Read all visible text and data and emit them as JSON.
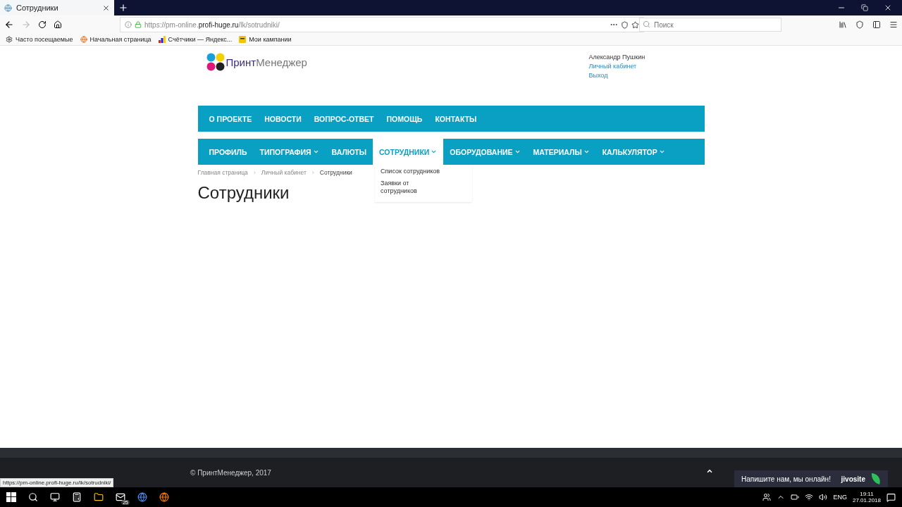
{
  "browser": {
    "tab_title": "Сотрудники",
    "url_prefix": "https://pm-online.",
    "url_domain": "profi-huge.ru",
    "url_path": "/lk/sotrudniki/",
    "search_placeholder": "Поиск",
    "bookmarks": [
      {
        "label": "Часто посещаемые",
        "kind": "gear"
      },
      {
        "label": "Начальная страница",
        "kind": "fox"
      },
      {
        "label": "Счётчики — Яндекс...",
        "kind": "chart"
      },
      {
        "label": "Мои кампании",
        "kind": "flag"
      }
    ]
  },
  "header": {
    "logo_bold": "Принт",
    "logo_light": "Менеджер",
    "user_name": "Александр Пушкин",
    "user_links": [
      "Личный кабинет",
      "Выход"
    ]
  },
  "top_menu": [
    "О ПРОЕКТЕ",
    "НОВОСТИ",
    "ВОПРОС-ОТВЕТ",
    "ПОМОЩЬ",
    "КОНТАКТЫ"
  ],
  "main_menu": [
    {
      "label": "ПРОФИЛЬ",
      "dropdown": false,
      "selected": false
    },
    {
      "label": "ТИПОГРАФИЯ",
      "dropdown": true,
      "selected": false
    },
    {
      "label": "ВАЛЮТЫ",
      "dropdown": false,
      "selected": false
    },
    {
      "label": "СОТРУДНИКИ",
      "dropdown": true,
      "selected": true
    },
    {
      "label": "ОБОРУДОВАНИЕ",
      "dropdown": true,
      "selected": false
    },
    {
      "label": "МАТЕРИАЛЫ",
      "dropdown": true,
      "selected": false
    },
    {
      "label": "КАЛЬКУЛЯТОР",
      "dropdown": true,
      "selected": false
    }
  ],
  "dropdown_items": [
    "Список сотрудников",
    "Заявки от сотрудников"
  ],
  "breadcrumbs": [
    "Главная страница",
    "Личный кабинет",
    "Сотрудники"
  ],
  "breadcrumb_separators": [
    "›",
    "›"
  ],
  "page_title": "Сотрудники",
  "footer": {
    "copyright": "© ПринтМенеджер, 2017",
    "chat_text": "Напишите нам, мы онлайн!",
    "chat_brand": "jivosite"
  },
  "status_url": "https://pm-online.profi-huge.ru/lk/sotrudniki/",
  "taskbar": {
    "badge": "25",
    "language": "ENG",
    "time": "19:11",
    "date": "27.01.2018"
  }
}
